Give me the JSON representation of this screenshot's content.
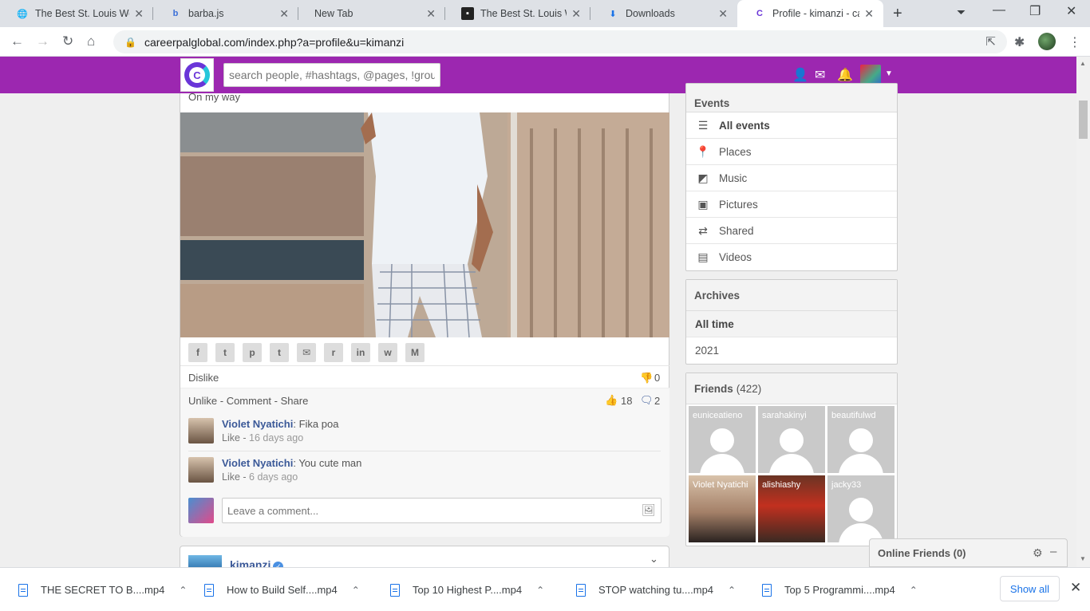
{
  "browser": {
    "tabs": [
      {
        "label": "The Best St. Louis Web",
        "icon": "globe-icon"
      },
      {
        "label": "barba.js",
        "icon": "barba-icon"
      },
      {
        "label": "New Tab",
        "icon": ""
      },
      {
        "label": "The Best St. Louis Web",
        "icon": "site-icon"
      },
      {
        "label": "Downloads",
        "icon": "download-icon"
      },
      {
        "label": "Profile - kimanzi - care",
        "icon": "careerpal-icon"
      }
    ],
    "url": "careerpalglobal.com/index.php?a=profile&u=kimanzi"
  },
  "header": {
    "logo_letter": "C",
    "search_placeholder": "search people, #hashtags, @pages, !groups"
  },
  "post": {
    "caption": "On my way",
    "dislike_label": "Dislike",
    "dislike_count": "0",
    "actions": {
      "unlike": "Unlike",
      "comment": "Comment",
      "share": "Share",
      "sep": " - "
    },
    "like_count": "18",
    "comment_count": "2",
    "share_icons": [
      "f",
      "t",
      "p",
      "t",
      "✉",
      "r",
      "in",
      "w",
      "M"
    ],
    "comments": [
      {
        "author": "Violet Nyatichi",
        "text": ": Fika poa",
        "like": "Like",
        "sep": " - ",
        "ago": "16 days ago"
      },
      {
        "author": "Violet Nyatichi",
        "text": ": You cute man",
        "like": "Like",
        "sep": " - ",
        "ago": "6 days ago"
      }
    ],
    "comment_placeholder": "Leave a comment..."
  },
  "next_post": {
    "author": "kimanzi"
  },
  "sidebar": {
    "events_title": "Events",
    "events": [
      {
        "label": "All events",
        "icon": "list-icon",
        "selected": true
      },
      {
        "label": "Places",
        "icon": "pin-icon"
      },
      {
        "label": "Music",
        "icon": "music-icon"
      },
      {
        "label": "Pictures",
        "icon": "picture-icon"
      },
      {
        "label": "Shared",
        "icon": "repeat-icon"
      },
      {
        "label": "Videos",
        "icon": "film-icon"
      }
    ],
    "archives_title": "Archives",
    "archives": [
      {
        "label": "All time",
        "selected": true
      },
      {
        "label": "2021"
      }
    ],
    "friends_title": "Friends",
    "friends_count": "(422)",
    "friends": [
      {
        "name": "euniceatieno",
        "photo": false
      },
      {
        "name": "sarahakinyi",
        "photo": false
      },
      {
        "name": "beautifulwd",
        "photo": false
      },
      {
        "name": "Violet Nyatichi",
        "photo": true,
        "color": "#b49a84"
      },
      {
        "name": "alishiashy",
        "photo": true,
        "color": "#7a3a2a"
      },
      {
        "name": "jacky33",
        "photo": false
      }
    ]
  },
  "online_friends": {
    "label": "Online Friends (0)"
  },
  "downloads": {
    "items": [
      "THE SECRET TO B....mp4",
      "How to Build Self....mp4",
      "Top 10 Highest P....mp4",
      "STOP watching tu....mp4",
      "Top 5 Programmi....mp4"
    ],
    "show_all": "Show all"
  },
  "colors": {
    "brand": "#9c27b0",
    "link": "#3b5998"
  }
}
